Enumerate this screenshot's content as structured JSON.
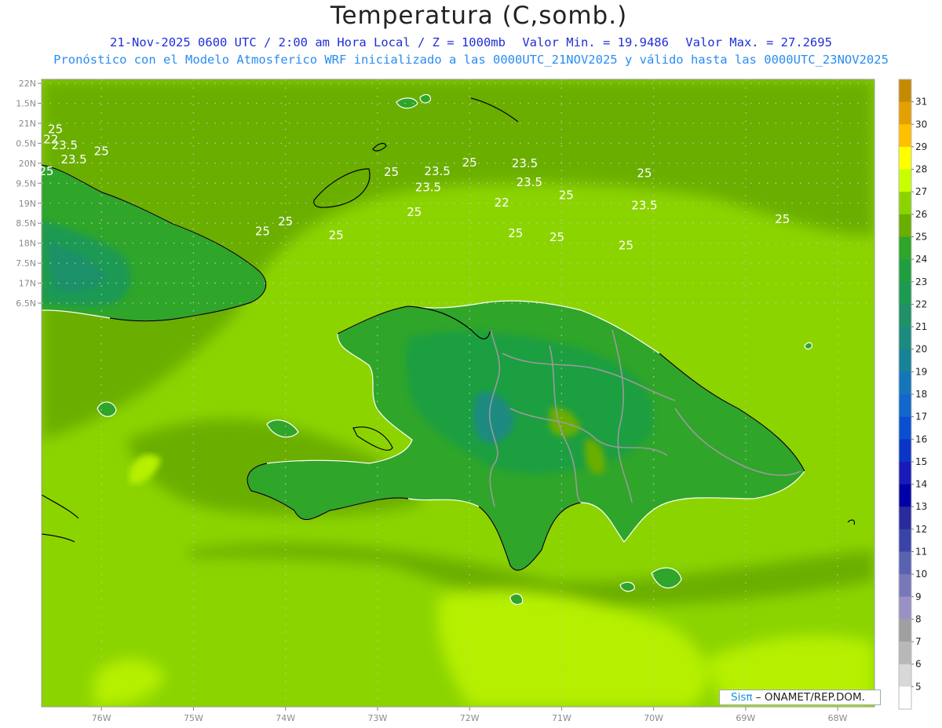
{
  "title": "Temperatura (C,somb.)",
  "subtitle_line1": {
    "datetime": "21-Nov-2025 0600 UTC / 2:00 am Hora Local / Z = 1000mb",
    "min": "Valor Min. = 19.9486",
    "max": "Valor Max. = 27.2695"
  },
  "subtitle_line2": "Pronóstico con el Modelo Atmosferico WRF inicializado a las 0000UTC_21NOV2025 y válido hasta las  0000UTC_23NOV2025",
  "credit": {
    "logo": "Sisπ",
    "text": "– ONAMET/REP.DOM."
  },
  "map": {
    "extent": {
      "lon_min": -76.65,
      "lon_max": -67.6,
      "lat_min": 6.4,
      "lat_max": 22.1
    },
    "lat_ticks": [
      "22N",
      "1.5N",
      "21N",
      "0.5N",
      "20N",
      "9.5N",
      "19N",
      "8.5N",
      "18N",
      "7.5N",
      "17N",
      "6.5N"
    ],
    "lat_values": [
      22,
      21.5,
      21,
      20.5,
      20,
      19.5,
      19,
      18.5,
      18,
      17.5,
      17,
      16.5
    ],
    "lon_ticks": [
      "76W",
      "75W",
      "74W",
      "73W",
      "72W",
      "71W",
      "70W",
      "69W",
      "68W"
    ],
    "lon_values": [
      -76,
      -75,
      -74,
      -73,
      -72,
      -71,
      -70,
      -69,
      -68
    ],
    "contour_labels": [
      {
        "text": "25",
        "lon": -76.5,
        "lat": 20.75
      },
      {
        "text": "22",
        "lon": -76.55,
        "lat": 20.5
      },
      {
        "text": "23.5",
        "lon": -76.4,
        "lat": 20.35
      },
      {
        "text": "25",
        "lon": -76.0,
        "lat": 20.2
      },
      {
        "text": "23.5",
        "lon": -76.3,
        "lat": 20.0
      },
      {
        "text": "25",
        "lon": -76.6,
        "lat": 19.7
      },
      {
        "text": "25",
        "lon": -72.85,
        "lat": 19.68
      },
      {
        "text": "25",
        "lon": -72.0,
        "lat": 19.92
      },
      {
        "text": "23.5",
        "lon": -71.4,
        "lat": 19.9
      },
      {
        "text": "23.5",
        "lon": -72.35,
        "lat": 19.7
      },
      {
        "text": "23.5",
        "lon": -72.45,
        "lat": 19.3
      },
      {
        "text": "23.5",
        "lon": -71.35,
        "lat": 19.43
      },
      {
        "text": "25",
        "lon": -70.1,
        "lat": 19.65
      },
      {
        "text": "25",
        "lon": -70.95,
        "lat": 19.1
      },
      {
        "text": "22",
        "lon": -71.65,
        "lat": 18.92
      },
      {
        "text": "23.5",
        "lon": -70.1,
        "lat": 18.85
      },
      {
        "text": "25",
        "lon": -72.6,
        "lat": 18.68
      },
      {
        "text": "25",
        "lon": -74.0,
        "lat": 18.45
      },
      {
        "text": "25",
        "lon": -74.25,
        "lat": 18.2
      },
      {
        "text": "25",
        "lon": -73.45,
        "lat": 18.1
      },
      {
        "text": "25",
        "lon": -71.5,
        "lat": 18.15
      },
      {
        "text": "25",
        "lon": -71.05,
        "lat": 18.05
      },
      {
        "text": "25",
        "lon": -68.6,
        "lat": 18.5
      },
      {
        "text": "25",
        "lon": -70.3,
        "lat": 17.85
      }
    ]
  },
  "colorbar": {
    "labels": [
      "31",
      "30",
      "29",
      "28",
      "27",
      "26",
      "25",
      "24",
      "23",
      "22",
      "21",
      "20",
      "19",
      "18",
      "17",
      "16",
      "15",
      "14",
      "13",
      "12",
      "11",
      "10",
      "9",
      "8",
      "7",
      "6",
      "5"
    ],
    "colors": [
      "#c48a00",
      "#e3a000",
      "#ffc000",
      "#ffff00",
      "#c8ff00",
      "#8cd400",
      "#6aae00",
      "#2fa52a",
      "#1f9f3f",
      "#1d9a52",
      "#1f9068",
      "#1d8a80",
      "#168399",
      "#1476b8",
      "#1266cc",
      "#0a4fd0",
      "#0a36c8",
      "#1a1ab8",
      "#0000a8",
      "#2a2a9e",
      "#3a44a8",
      "#5862b0",
      "#7878b8",
      "#9a90c4",
      "#a0a0a0",
      "#b8b8b8",
      "#d8d8d8",
      "#ffffff"
    ]
  }
}
